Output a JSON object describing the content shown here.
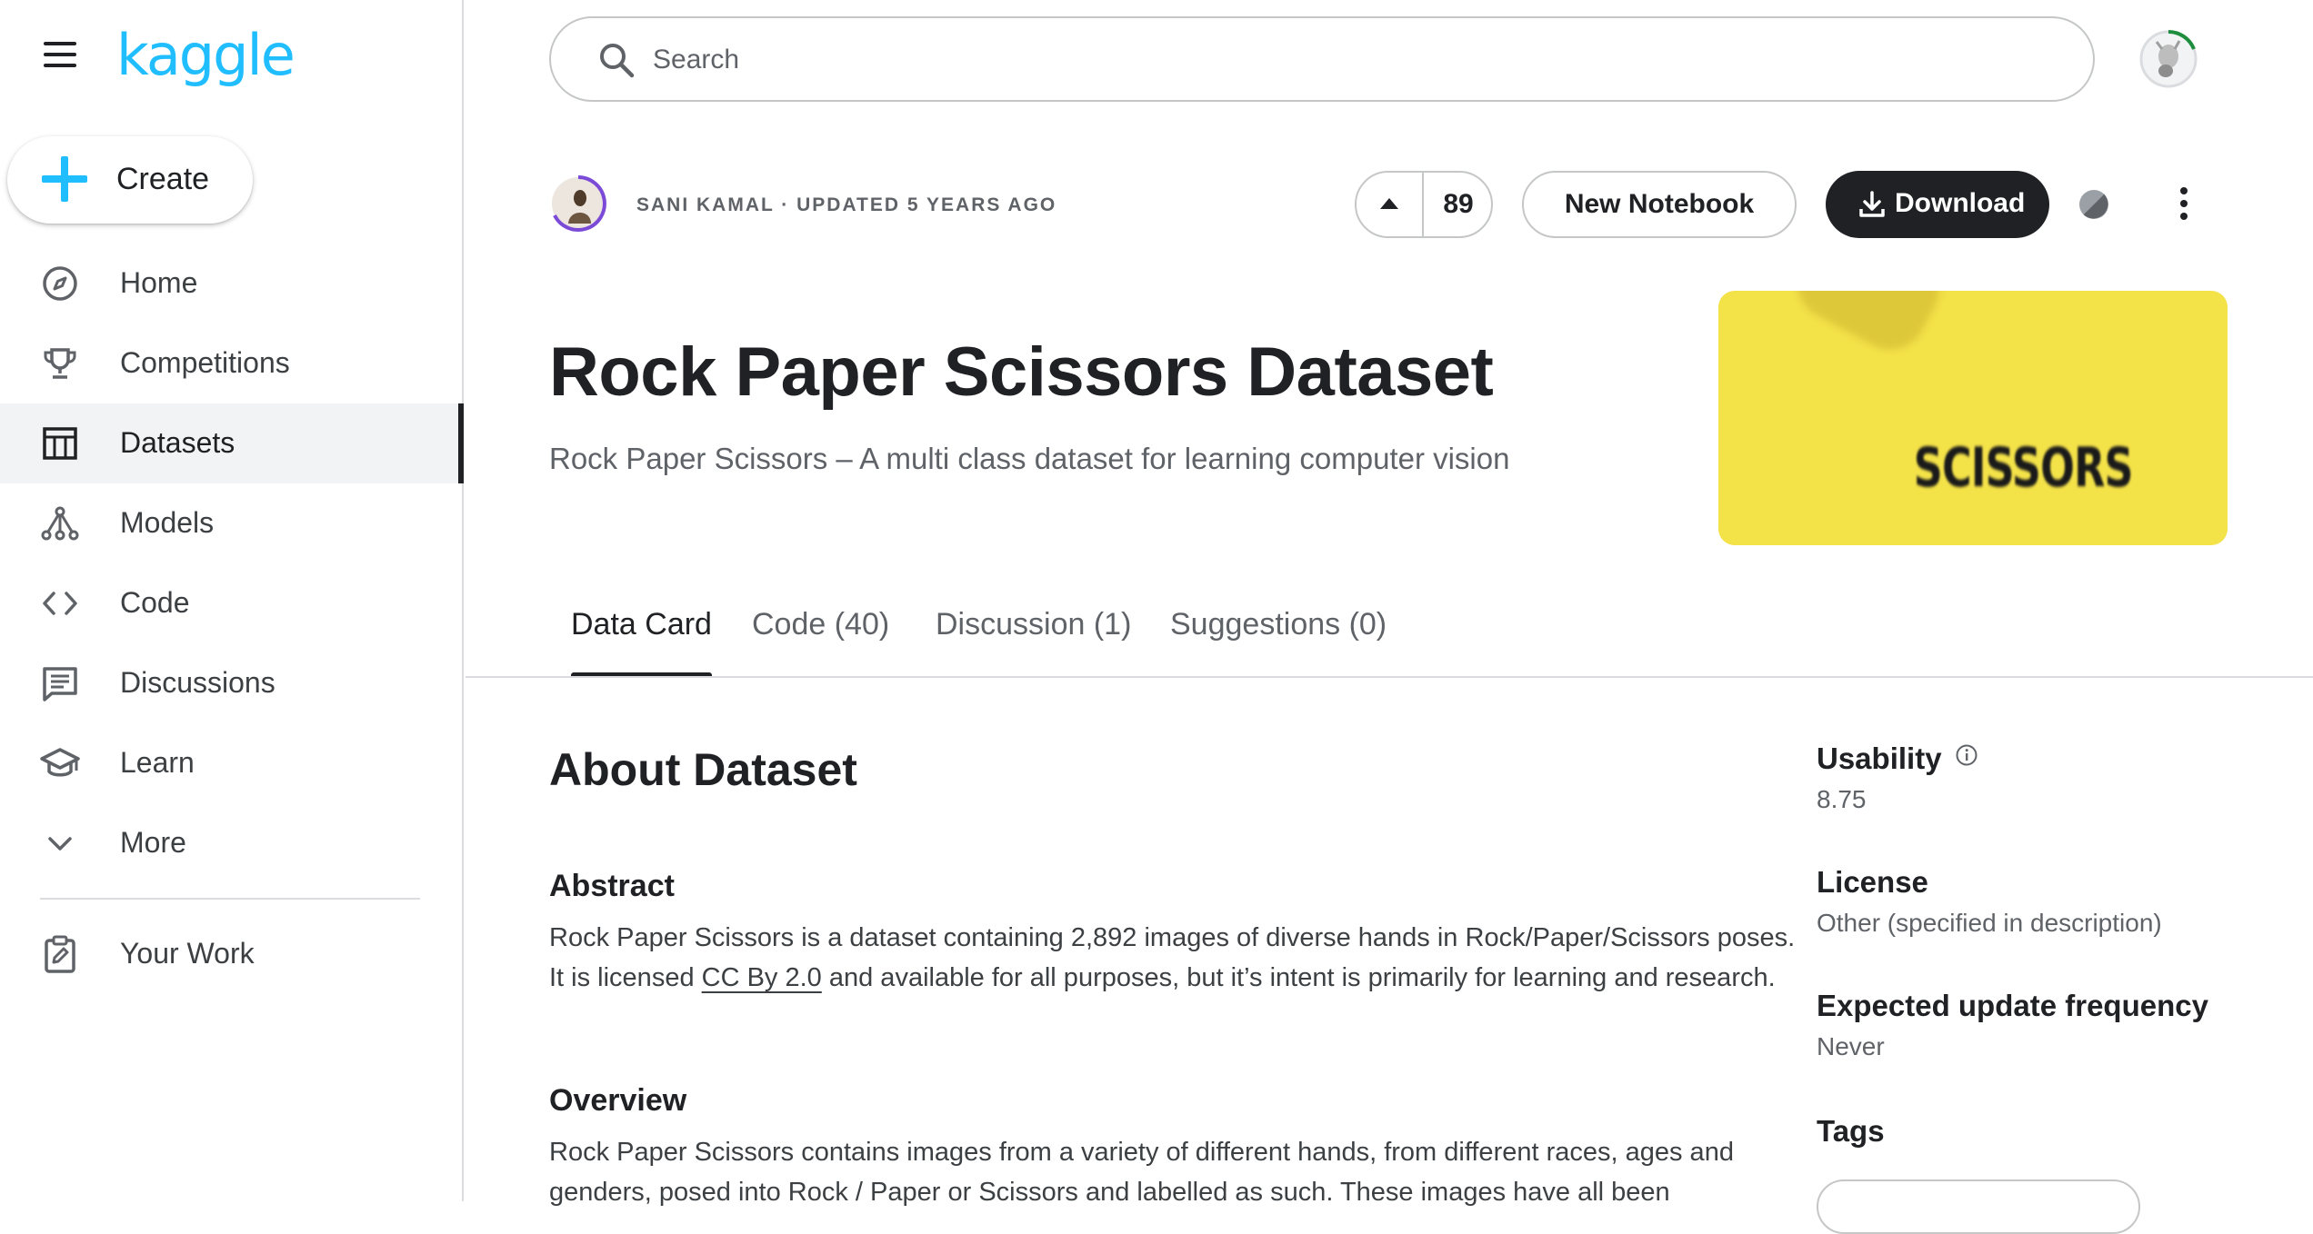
{
  "sidebar": {
    "logo": "kaggle",
    "create_label": "Create",
    "items": [
      {
        "label": "Home",
        "icon": "compass-icon"
      },
      {
        "label": "Competitions",
        "icon": "trophy-icon"
      },
      {
        "label": "Datasets",
        "icon": "table-icon",
        "active": true
      },
      {
        "label": "Models",
        "icon": "models-icon"
      },
      {
        "label": "Code",
        "icon": "code-icon"
      },
      {
        "label": "Discussions",
        "icon": "comments-icon"
      },
      {
        "label": "Learn",
        "icon": "school-icon"
      },
      {
        "label": "More",
        "icon": "chevron-down-icon"
      }
    ],
    "your_work": "Your Work"
  },
  "search": {
    "placeholder": "Search",
    "value": ""
  },
  "dataset": {
    "meta": "SANI KAMAL · UPDATED 5 YEARS AGO",
    "upvotes": "89",
    "new_notebook_label": "New Notebook",
    "download_label": "Download",
    "title": "Rock Paper Scissors Dataset",
    "subtitle": "Rock Paper Scissors – A multi class dataset for learning computer vision",
    "thumbnail_text": "SCISSORS"
  },
  "tabs": [
    {
      "label": "Data Card",
      "active": true
    },
    {
      "label": "Code (40)"
    },
    {
      "label": "Discussion (1)"
    },
    {
      "label": "Suggestions (0)"
    }
  ],
  "about": {
    "heading": "About Dataset",
    "abstract_heading": "Abstract",
    "abstract_before": "Rock Paper Scissors is a dataset containing 2,892 images of diverse hands in Rock/Paper/Scissors poses. It is licensed ",
    "abstract_link": "CC By 2.0",
    "abstract_after": " and available for all purposes, but it’s intent is primarily for learning and research.",
    "overview_heading": "Overview",
    "overview_text": "Rock Paper Scissors contains images from a variety of different hands, from different races, ages and genders, posed into Rock / Paper or Scissors and labelled as such. These images have all been"
  },
  "side": {
    "usability_label": "Usability",
    "usability_value": "8.75",
    "license_label": "License",
    "license_value": "Other (specified in description)",
    "frequency_label": "Expected update frequency",
    "frequency_value": "Never",
    "tags_label": "Tags"
  },
  "colors": {
    "brand": "#20beff",
    "dark_button": "#202124",
    "thumbnail_bg": "#f4e249"
  }
}
